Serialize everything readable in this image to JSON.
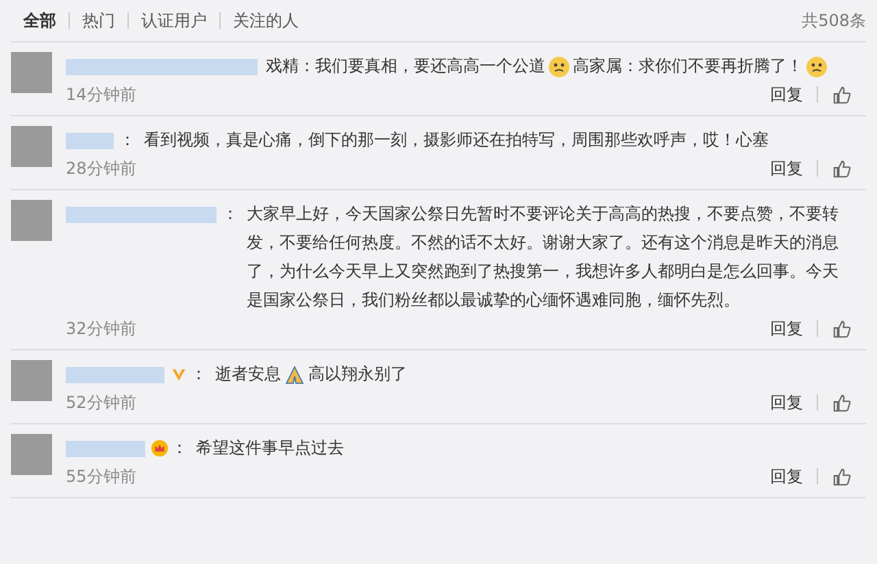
{
  "tabs": [
    {
      "label": "全部",
      "selected": true
    },
    {
      "label": "热门",
      "selected": false
    },
    {
      "label": "认证用户",
      "selected": false
    },
    {
      "label": "关注的人",
      "selected": false
    }
  ],
  "total": "共508条",
  "comments": [
    {
      "parts": [
        {
          "kind": "text",
          "text": "戏精：我们要真相，要还高高一个公道"
        },
        {
          "kind": "emoji"
        },
        {
          "kind": "text",
          "text": "高家属：求你们不要再折腾了！"
        },
        {
          "kind": "emoji"
        }
      ],
      "time": "14分钟前",
      "reply": "回复"
    },
    {
      "colon": "：",
      "parts": [
        {
          "kind": "text",
          "text": "看到视频，真是心痛，倒下的那一刻，摄影师还在拍特写，周围那些欢呼声，哎！心塞"
        }
      ],
      "time": "28分钟前",
      "reply": "回复"
    },
    {
      "colon": "：",
      "parts": [
        {
          "kind": "text",
          "text": "大家早上好，今天国家公祭日先暂时不要评论关于高高的热搜，不要点赞，不要转发，不要给任何热度。不然的话不太好。谢谢大家了。还有这个消息是昨天的消息了，为什么今天早上又突然跑到了热搜第一，我想许多人都明白是怎么回事。今天是国家公祭日，我们粉丝都以最诚挚的心缅怀遇难同胞，缅怀先烈。"
        }
      ],
      "time": "32分钟前",
      "reply": "回复"
    },
    {
      "badge": {
        "kind": "verified"
      },
      "colon": "：",
      "parts": [
        {
          "kind": "text",
          "text": "逝者安息"
        },
        {
          "kind": "hands"
        },
        {
          "kind": "text",
          "text": "高以翔永别了"
        }
      ],
      "time": "52分钟前",
      "reply": "回复"
    },
    {
      "badge": {
        "kind": "crown"
      },
      "colon": "：",
      "parts": [
        {
          "kind": "text",
          "text": "希望这件事早点过去"
        }
      ],
      "time": "55分钟前",
      "reply": "回复"
    }
  ]
}
